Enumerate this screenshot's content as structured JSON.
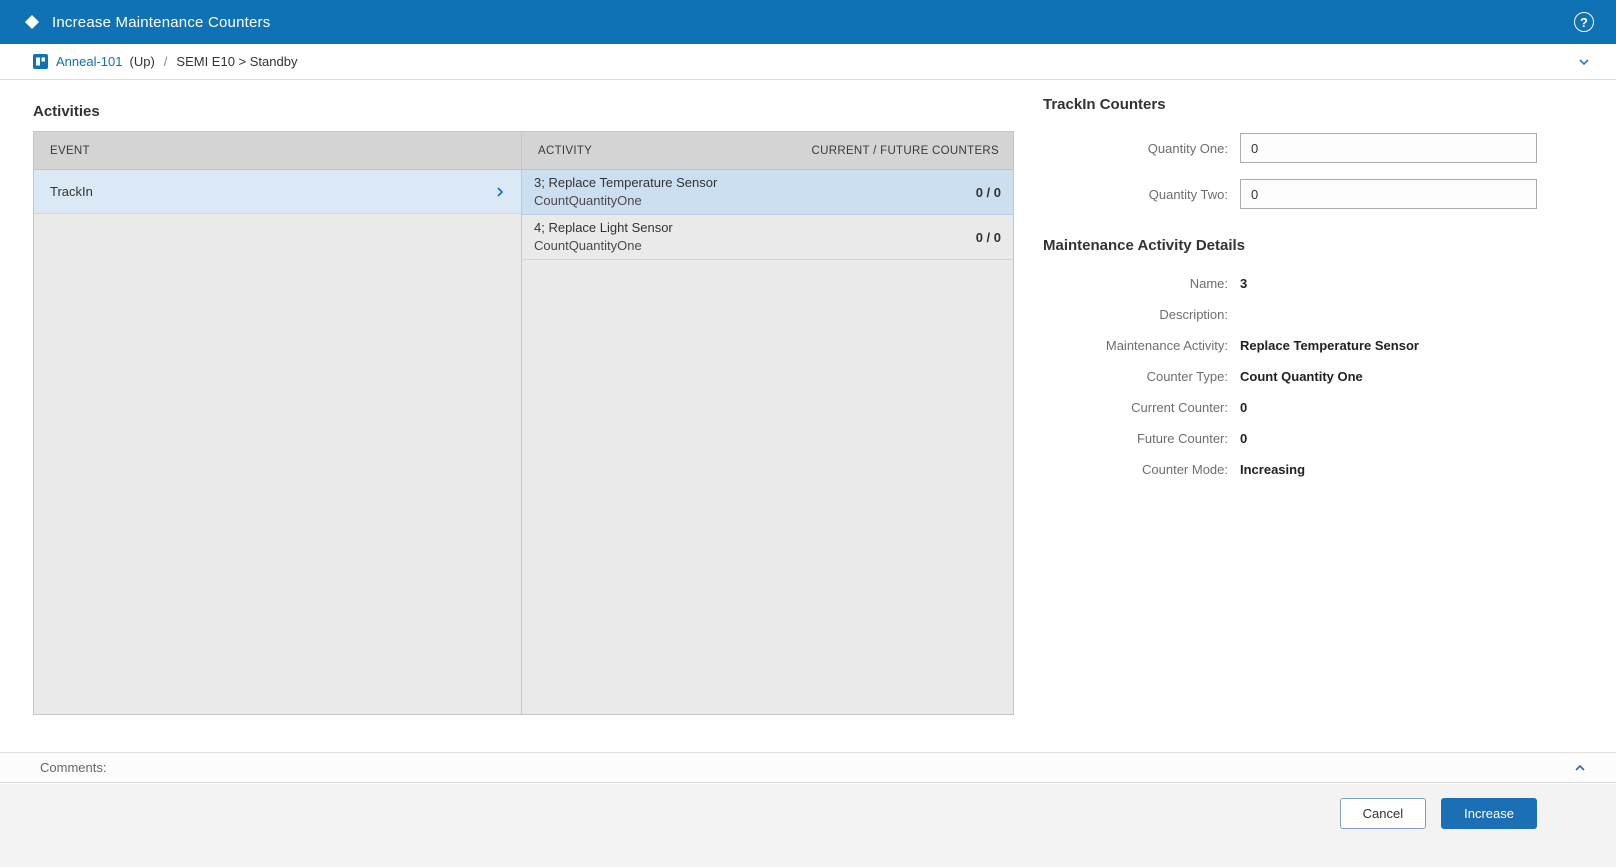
{
  "header": {
    "title": "Increase Maintenance Counters"
  },
  "icons": {
    "help": "?",
    "app_logo": "diamond-icon",
    "resource": "resource-icon",
    "breadcrumb_collapse": "chevron-down-icon",
    "event_expand": "chevron-right-icon",
    "comments_collapse": "chevron-up-icon"
  },
  "breadcrumb": {
    "entity": "Anneal-101",
    "up": "(Up)",
    "separator": "/",
    "state": "SEMI E10 > Standby"
  },
  "activities": {
    "title": "Activities",
    "event_header": "EVENT",
    "activity_header": "ACTIVITY",
    "counters_header": "CURRENT / FUTURE COUNTERS",
    "events": [
      {
        "name": "TrackIn",
        "selected": true
      }
    ],
    "rows": [
      {
        "line1": "3; Replace Temperature Sensor",
        "line2": "CountQuantityOne",
        "counters": "0 / 0",
        "selected": true
      },
      {
        "line1": "4; Replace Light Sensor",
        "line2": "CountQuantityOne",
        "counters": "0 / 0",
        "selected": false
      }
    ]
  },
  "trackin": {
    "title": "TrackIn Counters",
    "fields": [
      {
        "label": "Quantity One:",
        "value": "0"
      },
      {
        "label": "Quantity Two:",
        "value": "0"
      }
    ]
  },
  "details": {
    "title": "Maintenance Activity Details",
    "rows": [
      {
        "label": "Name:",
        "value": "3"
      },
      {
        "label": "Description:",
        "value": ""
      },
      {
        "label": "Maintenance Activity:",
        "value": "Replace Temperature Sensor"
      },
      {
        "label": "Counter Type:",
        "value": "Count Quantity One"
      },
      {
        "label": "Current Counter:",
        "value": "0"
      },
      {
        "label": "Future Counter:",
        "value": "0"
      },
      {
        "label": "Counter Mode:",
        "value": "Increasing"
      }
    ]
  },
  "comments": {
    "label": "Comments:"
  },
  "footer": {
    "cancel_label": "Cancel",
    "increase_label": "Increase"
  },
  "colors": {
    "header_bg": "#0e72b5",
    "link": "#0e72b5",
    "table_header_bg": "#d4d4d4",
    "event_selected_bg": "#dbe9f7",
    "activity_selected_bg": "#cbdff1",
    "table_body_bg": "#eaeaea",
    "primary_button_bg": "#1a6fb5",
    "footer_bg": "#f3f3f3"
  }
}
